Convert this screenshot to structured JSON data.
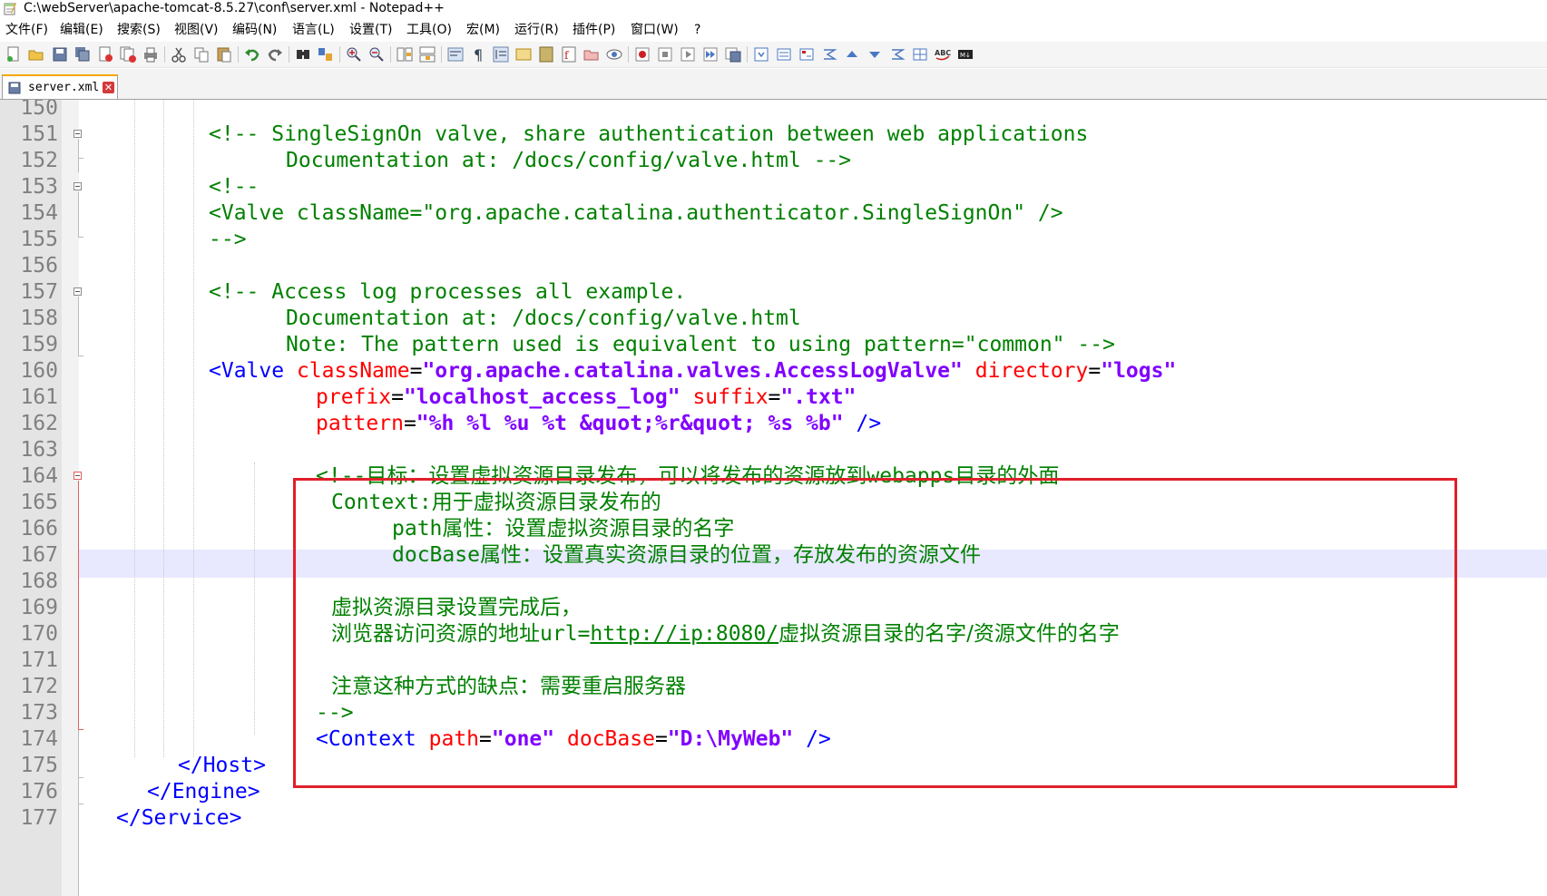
{
  "window": {
    "title": "C:\\webServer\\apache-tomcat-8.5.27\\conf\\server.xml - Notepad++"
  },
  "menu": {
    "items": [
      "文件(F)",
      "编辑(E)",
      "搜索(S)",
      "视图(V)",
      "编码(N)",
      "语言(L)",
      "设置(T)",
      "工具(O)",
      "宏(M)",
      "运行(R)",
      "插件(P)",
      "窗口(W)",
      "?"
    ]
  },
  "tabs": [
    {
      "label": "server.xml",
      "active": true
    }
  ],
  "editor": {
    "current_line": 166,
    "lines": [
      {
        "n": "150"
      },
      {
        "n": "151"
      },
      {
        "n": "152"
      },
      {
        "n": "153"
      },
      {
        "n": "154"
      },
      {
        "n": "155"
      },
      {
        "n": "156"
      },
      {
        "n": "157"
      },
      {
        "n": "158"
      },
      {
        "n": "159"
      },
      {
        "n": "160"
      },
      {
        "n": "161"
      },
      {
        "n": "162"
      },
      {
        "n": "163"
      },
      {
        "n": "164"
      },
      {
        "n": "165"
      },
      {
        "n": "166"
      },
      {
        "n": "167"
      },
      {
        "n": "168"
      },
      {
        "n": "169"
      },
      {
        "n": "170"
      },
      {
        "n": "171"
      },
      {
        "n": "172"
      },
      {
        "n": "173"
      },
      {
        "n": "174"
      },
      {
        "n": "175"
      },
      {
        "n": "176"
      },
      {
        "n": "177"
      }
    ],
    "code": {
      "l151": "<!-- SingleSignOn valve, share authentication between web applications",
      "l152": "Documentation at: /docs/config/valve.html -->",
      "l153": "<!--",
      "l154": "<Valve className=\"org.apache.catalina.authenticator.SingleSignOn\" />",
      "l155": "-->",
      "l157": "<!-- Access log processes all example.",
      "l158": "Documentation at: /docs/config/valve.html",
      "l159": "Note: The pattern used is equivalent to using pattern=\"common\" -->",
      "l160_tag": "<Valve",
      "l160_attr1": "className",
      "l160_val1": "\"org.apache.catalina.valves.AccessLogValve\"",
      "l160_attr2": "directory",
      "l160_val2": "\"logs\"",
      "l161_attr1": "prefix",
      "l161_val1": "\"localhost_access_log\"",
      "l161_attr2": "suffix",
      "l161_val2": "\".txt\"",
      "l162_attr": "pattern",
      "l162_val": "\"%h %l %u %t &quot;%r&quot; %s %b\"",
      "l162_end": "/>",
      "l164_open": "<!--",
      "l164_text": "目标：设置虚拟资源目录发布，可以将发布的资源放到",
      "l164_word": "webapps",
      "l164_text2": "目录的外面",
      "l165_word": "Context:",
      "l165_text": "用于虚拟资源目录发布的",
      "l166_word": "path",
      "l166_text": "属性：设置虚拟资源目录的名字",
      "l167_word": "docBase",
      "l167_text": "属性：设置真实资源目录的位置，存放发布的资源文件",
      "l169_text": "虚拟资源目录设置完成后，",
      "l170_text": "浏览器访问资源的地址",
      "l170_word": "url=",
      "l170_link": "http://ip:8080/",
      "l170_text2": "虚拟资源目录的名字/资源文件的名字",
      "l172_text": "注意这种方式的缺点：需要重启服务器",
      "l173": "-->",
      "l174_tag": "<Context",
      "l174_attr1": "path",
      "l174_val1": "\"one\"",
      "l174_attr2": "docBase",
      "l174_val2": "\"D:\\MyWeb\"",
      "l174_end": "/>",
      "l175": "</Host>",
      "l176": "</Engine>",
      "l177": "</Service>"
    }
  },
  "colors": {
    "comment": "#008000",
    "tag": "#0000ff",
    "attribute": "#ff0000",
    "value": "#8000ff",
    "highlight_border": "#e0202a",
    "current_line_bg": "#e8e8ff"
  },
  "icons": [
    "new-file-icon",
    "open-icon",
    "save-icon",
    "save-all-icon",
    "close-icon",
    "close-all-icon",
    "print-icon",
    "cut-icon",
    "copy-icon",
    "paste-icon",
    "undo-icon",
    "redo-icon",
    "find-icon",
    "replace-icon",
    "zoom-in-icon",
    "zoom-out-icon",
    "sync-v-icon",
    "sync-h-icon",
    "word-wrap-icon",
    "show-all-chars-icon",
    "indent-guide-icon",
    "udl-icon",
    "doc-map-icon",
    "function-list-icon",
    "folder-workspace-icon",
    "monitor-icon",
    "record-macro-icon",
    "stop-macro-icon",
    "play-macro-icon",
    "run-macro-multiple-icon",
    "save-macro-icon",
    "plugin-1-icon",
    "plugin-2-icon",
    "plugin-3-icon",
    "plugin-4-icon",
    "arrow-up-icon",
    "arrow-down-icon",
    "plugin-5-icon",
    "plugin-6-icon",
    "spellcheck-icon",
    "md-icon"
  ]
}
